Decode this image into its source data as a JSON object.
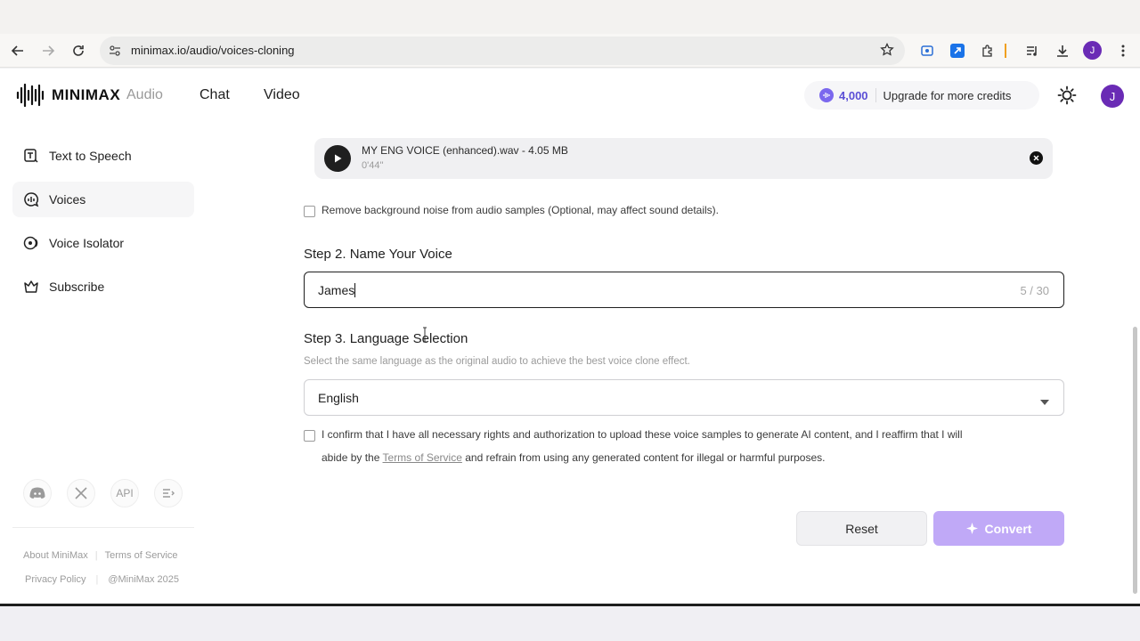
{
  "browser": {
    "url": "minimax.io/audio/voices-cloning",
    "profile_initial": "J"
  },
  "header": {
    "logo_text": "MINIMAX",
    "nav": [
      "Audio",
      "Chat",
      "Video"
    ],
    "credits": "4,000",
    "upgrade_label": "Upgrade for more credits",
    "avatar_initial": "J"
  },
  "sidebar": {
    "items": [
      {
        "label": "Text to Speech",
        "icon": "text-to-speech-icon"
      },
      {
        "label": "Voices",
        "icon": "voices-icon"
      },
      {
        "label": "Voice Isolator",
        "icon": "voice-isolator-icon"
      },
      {
        "label": "Subscribe",
        "icon": "crown-icon"
      }
    ],
    "social": {
      "api_label": "API"
    },
    "footer": {
      "about": "About MiniMax",
      "terms": "Terms of Service",
      "privacy": "Privacy Policy",
      "copyright": "@MiniMax 2025"
    }
  },
  "main": {
    "audio_file": {
      "name": "MY ENG VOICE (enhanced).wav - 4.05 MB",
      "duration": "0'44''"
    },
    "noise_checkbox_label": "Remove background noise from audio samples (Optional, may affect sound details).",
    "step2_title": "Step 2. Name Your Voice",
    "name_value": "James",
    "name_count": "5 / 30",
    "step3_title": "Step 3. Language Selection",
    "step3_hint": "Select the same language as the original audio to achieve the best voice clone effect.",
    "language_value": "English",
    "confirm_text_1": "I confirm that I have all necessary rights and authorization to upload these voice samples to generate AI content, and I reaffirm that I will",
    "confirm_text_2a": "abide by the",
    "confirm_link": "Terms of Service",
    "confirm_text_2b": "and refrain from using any generated content for illegal or harmful purposes.",
    "reset_label": "Reset",
    "convert_label": "Convert"
  },
  "colors": {
    "accent": "#6a2bb5",
    "convert_button": "#c0a9f7",
    "credits": "#5b4fd6"
  }
}
